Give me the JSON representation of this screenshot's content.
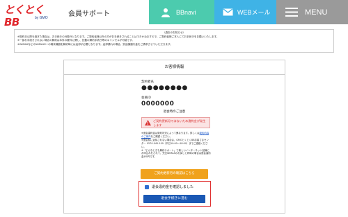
{
  "header": {
    "logo_text": "とくとくBB",
    "logo_sub": "by GMO",
    "site_title": "会員サポート",
    "nav": [
      {
        "label": "BBnavi",
        "icon": "person-icon",
        "color": "#4ccbae"
      },
      {
        "label": "WEBメール",
        "icon": "mail-icon",
        "color": "#3fb3e6"
      },
      {
        "label": "MENU",
        "icon": "hamburger-icon",
        "color": "#9a9a9a"
      }
    ]
  },
  "notice": {
    "title": "〈過去のお知らせ〉",
    "lines": [
      "※契約日以降を過ぎた場合は、お手続きの対象外となります。ご契約者様以外の方がお手続きされることはできかねますので、ご契約者様ご本人にてお手続きをお願いいたします。",
      "※一部お手続きされない場合の解約は本件の要件に関し、記載の解約手続き等のキャンセルが可能です。",
      "※WiMAXなどのWiMAX2+の端末機器を解約時には返却が必要となります。返却漏れの場合、別途機器代金をご請求させていただきます。"
    ]
  },
  "panel": {
    "title": "お客様情報",
    "contract_name_label": "契約者名",
    "contract_name_value": "●●●●●●●●",
    "member_id_label": "会員ID",
    "member_id_value": "0000000",
    "attention_title": "退会時のご注意",
    "alert_text": "ご契約更新月ではないため違約金が発生します",
    "notes": {
      "n1_pre": "※退会違約金は契約状況によって異なります。詳しくは",
      "n1_link": "契約内容のご案内",
      "n1_post": "をご確認ください。",
      "n2": "※退会前に返却されない場合は、GMOとくとくBBお客さまセンター 0570-045-109（平日10:00〜18:00）までご連絡ください。",
      "n3": "※「どんなときも解約サポート」で新しいインターネット回線にお申込みをされて、完全WiMAXのお戻しと同時の場合は退会違約金が0円です。"
    },
    "orange_button": "ご契約更新月の確認はこちら",
    "checkbox_label": "退会違約金を確認しました",
    "blue_button": "退会手続きに進む"
  }
}
